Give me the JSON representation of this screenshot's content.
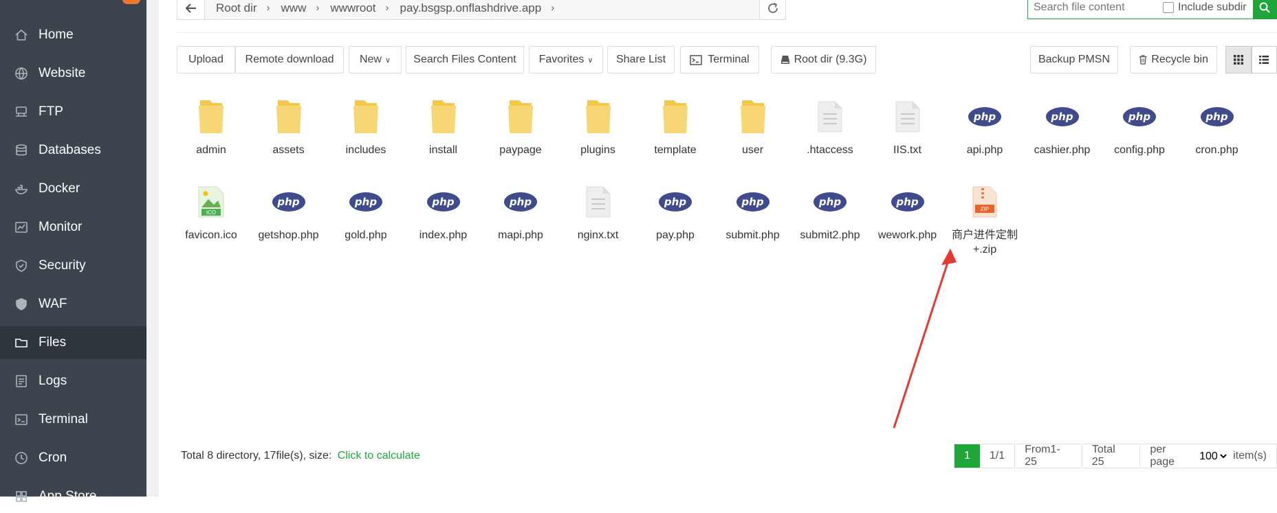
{
  "sidebar": {
    "items": [
      {
        "label": "Home",
        "icon": "home-icon"
      },
      {
        "label": "Website",
        "icon": "globe-icon"
      },
      {
        "label": "FTP",
        "icon": "ftp-icon"
      },
      {
        "label": "Databases",
        "icon": "database-icon"
      },
      {
        "label": "Docker",
        "icon": "docker-icon"
      },
      {
        "label": "Monitor",
        "icon": "monitor-icon"
      },
      {
        "label": "Security",
        "icon": "shield-icon"
      },
      {
        "label": "WAF",
        "icon": "waf-shield-icon"
      },
      {
        "label": "Files",
        "icon": "folder-icon"
      },
      {
        "label": "Logs",
        "icon": "logs-icon"
      },
      {
        "label": "Terminal",
        "icon": "terminal-icon"
      },
      {
        "label": "Cron",
        "icon": "clock-icon"
      },
      {
        "label": "App Store",
        "icon": "appstore-icon"
      }
    ],
    "active": "Files"
  },
  "path": {
    "crumbs": [
      "Root dir",
      "www",
      "wwwroot",
      "pay.bsgsp.onflashdrive.app"
    ]
  },
  "search": {
    "placeholder": "Search file content",
    "include_subdir": "Include subdir"
  },
  "toolbar": {
    "upload": "Upload",
    "remote_download": "Remote download",
    "new": "New",
    "search_files": "Search Files Content",
    "favorites": "Favorites",
    "share_list": "Share List",
    "terminal": "Terminal",
    "root_dir": "Root dir (9.3G)",
    "backup": "Backup PMSN",
    "recycle": "Recycle bin"
  },
  "files": [
    {
      "name": "admin",
      "type": "folder"
    },
    {
      "name": "assets",
      "type": "folder"
    },
    {
      "name": "includes",
      "type": "folder"
    },
    {
      "name": "install",
      "type": "folder"
    },
    {
      "name": "paypage",
      "type": "folder"
    },
    {
      "name": "plugins",
      "type": "folder"
    },
    {
      "name": "template",
      "type": "folder"
    },
    {
      "name": "user",
      "type": "folder"
    },
    {
      "name": ".htaccess",
      "type": "text"
    },
    {
      "name": "IIS.txt",
      "type": "text"
    },
    {
      "name": "api.php",
      "type": "php"
    },
    {
      "name": "cashier.php",
      "type": "php"
    },
    {
      "name": "config.php",
      "type": "php"
    },
    {
      "name": "cron.php",
      "type": "php"
    },
    {
      "name": "favicon.ico",
      "type": "ico"
    },
    {
      "name": "getshop.php",
      "type": "php"
    },
    {
      "name": "gold.php",
      "type": "php"
    },
    {
      "name": "index.php",
      "type": "php"
    },
    {
      "name": "mapi.php",
      "type": "php"
    },
    {
      "name": "nginx.txt",
      "type": "text"
    },
    {
      "name": "pay.php",
      "type": "php"
    },
    {
      "name": "submit.php",
      "type": "php"
    },
    {
      "name": "submit2.php",
      "type": "php"
    },
    {
      "name": "wework.php",
      "type": "php"
    },
    {
      "name": "商户进件定制+.zip",
      "type": "zip"
    }
  ],
  "icon_text": {
    "php": "php",
    "ico": "ICO",
    "zip": "ZIP"
  },
  "footer": {
    "summary": "Total 8 directory, 17file(s), size:",
    "calc": "Click to calculate",
    "page": "1",
    "pages": "1/1",
    "range": "From1-25",
    "total": "Total 25",
    "per_page_label": "per page",
    "per_page_value": "100",
    "items_label": "item(s)"
  },
  "colors": {
    "accent": "#20a53a",
    "sidebar": "#3c444d",
    "php": "#3f4b8c",
    "folder": "#f7d674",
    "arrow": "#e53935"
  }
}
